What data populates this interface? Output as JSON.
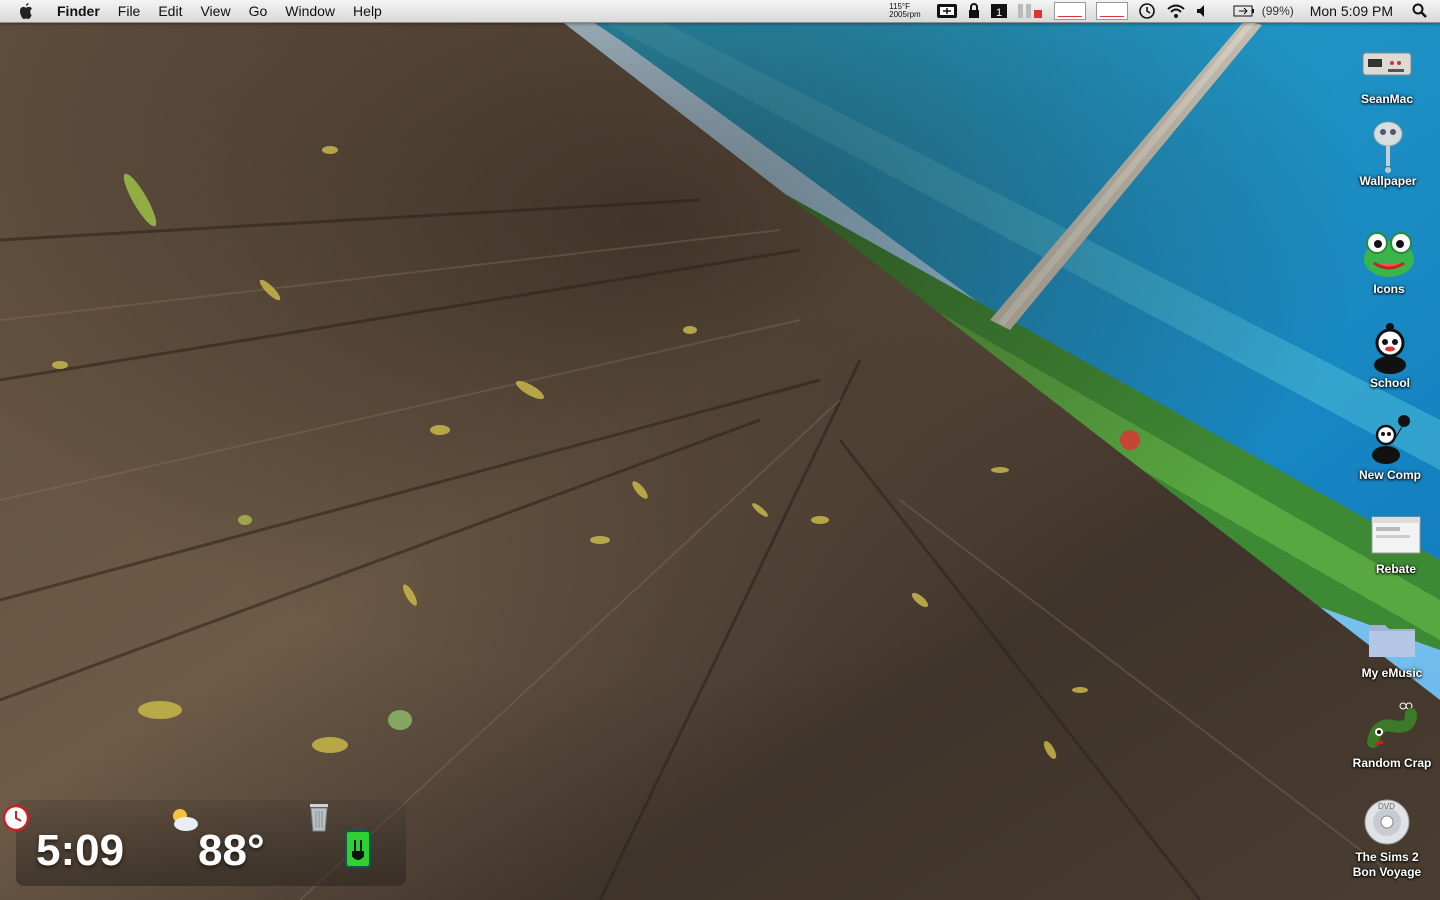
{
  "menubar": {
    "app_name": "Finder",
    "menus": [
      "File",
      "Edit",
      "View",
      "Go",
      "Window",
      "Help"
    ],
    "temp_readout": {
      "temp": "115°F",
      "fan": "2005rpm"
    },
    "battery_percent": "(99%)",
    "clock": "Mon 5:09 PM",
    "icons": [
      "apple-icon",
      "screen-sharing-icon",
      "lock-icon",
      "stats-icon",
      "cpu-monitor-icon",
      "memory-graph-icon",
      "network-graph-icon",
      "time-machine-icon",
      "wifi-icon",
      "volume-icon",
      "battery-icon",
      "spotlight-icon"
    ]
  },
  "desktop_icons": [
    {
      "label": "SeanMac",
      "icon": "hard-drive-icon"
    },
    {
      "label": "Wallpaper",
      "icon": "wallpaper-folder-icon"
    },
    {
      "label": "Icons",
      "icon": "frog-icon"
    },
    {
      "label": "School",
      "icon": "panda-icon"
    },
    {
      "label": "New Comp",
      "icon": "balloon-icon"
    },
    {
      "label": "Rebate",
      "icon": "window-icon"
    },
    {
      "label": "My eMusic",
      "icon": "folder-icon"
    },
    {
      "label": "Random Crap",
      "icon": "worm-icon"
    },
    {
      "label": "The Sims 2\nBon Voyage",
      "icon": "dvd-icon"
    }
  ],
  "widgets": {
    "time": "5:09",
    "temperature": "88°",
    "weather_icon": "partly-sunny-icon",
    "clock_icon": "alarm-clock-icon",
    "trash_icon": "trash-icon",
    "battery_icon": "battery-charging-icon"
  },
  "colors": {
    "menubar_top": "#f4f4f4",
    "menubar_bottom": "#d9d9d9",
    "sky": "#8cc8f0",
    "sea": "#1e9ac8",
    "wood_dark": "#3b3128",
    "wood_light": "#6b5b4a",
    "battery_green": "#2fd02f"
  }
}
